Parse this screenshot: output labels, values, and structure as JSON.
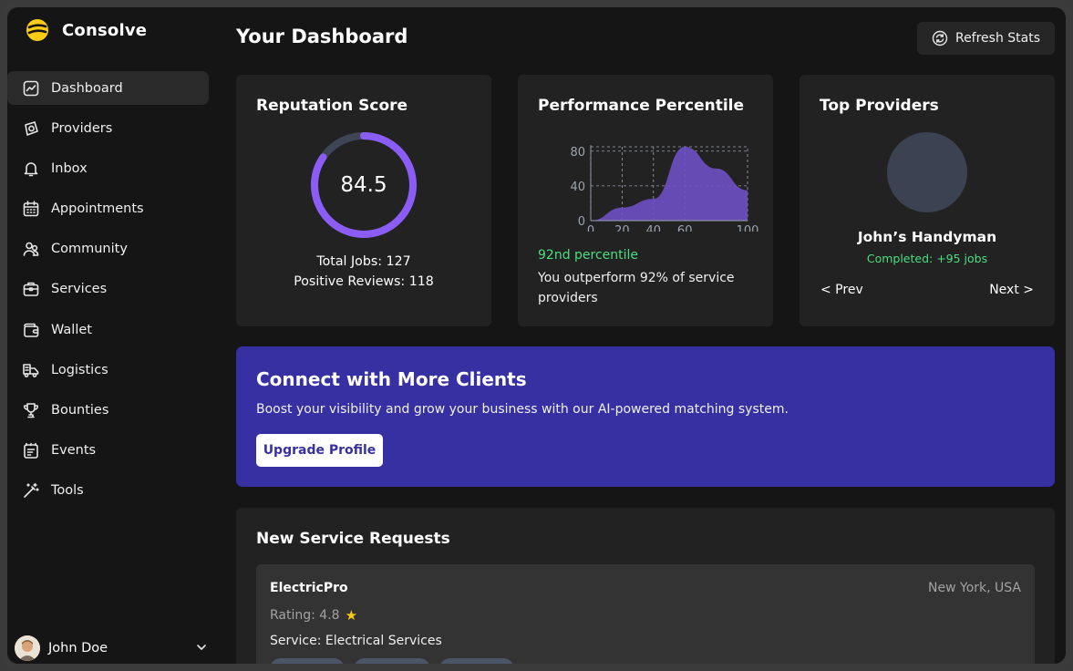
{
  "app": {
    "name": "Consolve",
    "brand_color": "#facc15"
  },
  "sidebar": {
    "items": [
      {
        "label": "Dashboard",
        "icon": "chart-line-icon",
        "active": true
      },
      {
        "label": "Providers",
        "icon": "disc-icon",
        "active": false
      },
      {
        "label": "Inbox",
        "icon": "bell-icon",
        "active": false
      },
      {
        "label": "Appointments",
        "icon": "calendar-icon",
        "active": false
      },
      {
        "label": "Community",
        "icon": "users-icon",
        "active": false
      },
      {
        "label": "Services",
        "icon": "briefcase-icon",
        "active": false
      },
      {
        "label": "Wallet",
        "icon": "wallet-icon",
        "active": false
      },
      {
        "label": "Logistics",
        "icon": "truck-icon",
        "active": false
      },
      {
        "label": "Bounties",
        "icon": "trophy-icon",
        "active": false
      },
      {
        "label": "Events",
        "icon": "clipboard-icon",
        "active": false
      },
      {
        "label": "Tools",
        "icon": "magic-wand-icon",
        "active": false
      }
    ],
    "user": {
      "name": "John Doe"
    }
  },
  "header": {
    "title": "Your Dashboard",
    "refresh_label": "Refresh Stats"
  },
  "reputation": {
    "title": "Reputation Score",
    "score": "84.5",
    "score_fraction": 0.845,
    "total_jobs": "Total Jobs: 127",
    "positive_reviews": "Positive Reviews: 118",
    "ring_color": "#8b5cf6"
  },
  "performance": {
    "title": "Performance Percentile",
    "percentile_label": "92nd percentile",
    "description": "You outperform 92% of service providers",
    "chart_data": {
      "type": "area",
      "x": [
        0,
        20,
        40,
        60,
        80,
        100
      ],
      "y": [
        0,
        15,
        25,
        85,
        60,
        35
      ],
      "xticks": [
        "0",
        "20",
        "40",
        "60",
        "100"
      ],
      "xtick_values": [
        0,
        20,
        40,
        60,
        100
      ],
      "yticks": [
        "0",
        "40",
        "80"
      ],
      "ytick_values": [
        0,
        40,
        80
      ],
      "xlim": [
        0,
        100
      ],
      "ylim": [
        0,
        85
      ],
      "grid": true,
      "fill_color": "#6d4fc2"
    }
  },
  "top_providers": {
    "title": "Top Providers",
    "name": "John’s Handyman",
    "completed": "Completed: +95 jobs",
    "prev_label": "< Prev",
    "next_label": "Next >"
  },
  "promo": {
    "title": "Connect with More Clients",
    "subtitle": "Boost your visibility and grow your business with our AI-powered matching system.",
    "button_label": "Upgrade Profile",
    "bg_color": "#3730a3"
  },
  "requests": {
    "title": "New Service Requests",
    "items": [
      {
        "name": "ElectricPro",
        "location": "New York, USA",
        "rating": "Rating: 4.8",
        "service": "Service: Electrical Services"
      }
    ]
  }
}
